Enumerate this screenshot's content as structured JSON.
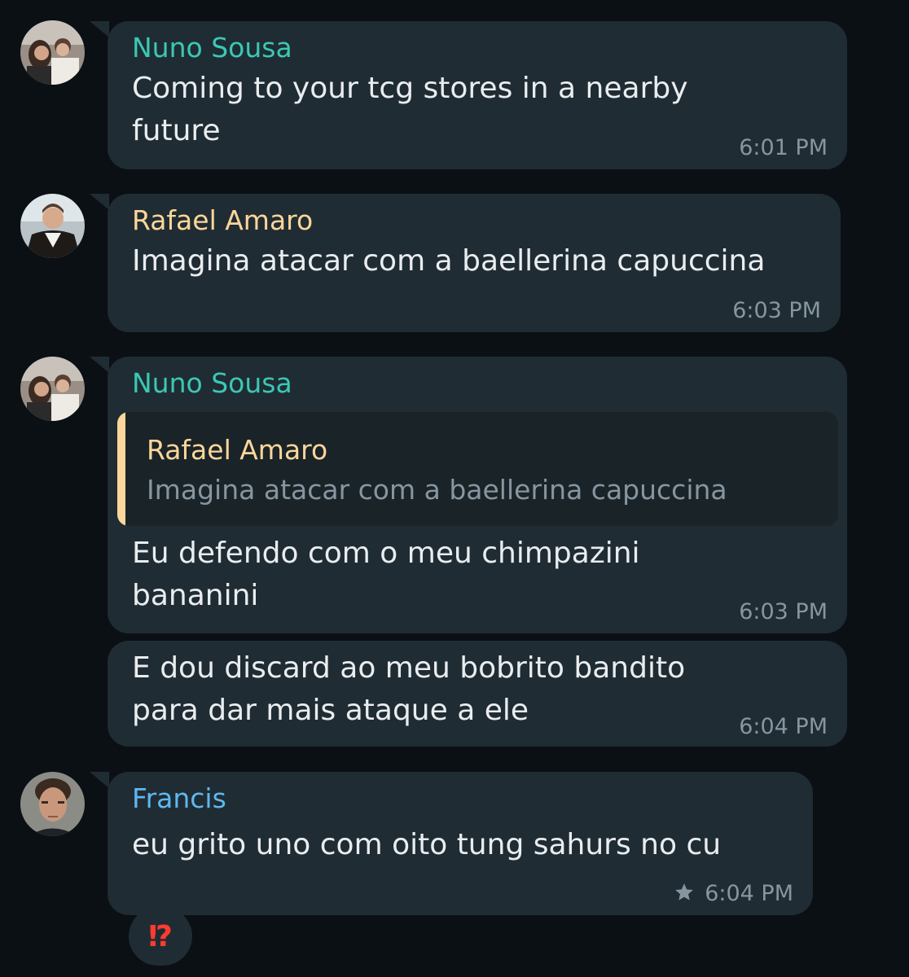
{
  "colors": {
    "background": "#0b1014",
    "bubble": "#202c33",
    "quote_bg": "#1a2328",
    "text": "#e9edef",
    "meta": "#8696a0",
    "nuno": "#3bc8b5",
    "rafael": "#fcd69a",
    "francis": "#5eb8f0",
    "reaction": "#ff3b30"
  },
  "messages": [
    {
      "sender": "Nuno Sousa",
      "line1": "Coming to your tcg stores in a nearby",
      "line2": "future",
      "time": "6:01 PM"
    },
    {
      "sender": "Rafael Amaro",
      "line1": "Imagina atacar com a baellerina capuccina",
      "time": "6:03 PM"
    },
    {
      "sender": "Nuno Sousa",
      "reply": {
        "sender": "Rafael Amaro",
        "text": "Imagina atacar com a baellerina capuccina"
      },
      "line1": "Eu defendo com o meu chimpazini",
      "line2": "bananini",
      "time": "6:03 PM"
    },
    {
      "line1": "E dou discard ao meu bobrito bandito",
      "line2": "para dar mais ataque a ele",
      "time": "6:04 PM"
    },
    {
      "sender": "Francis",
      "line1": "eu grito uno com oito tung sahurs no cu",
      "time": "6:04 PM",
      "starred_icon": "star-icon",
      "reaction": "⁉"
    }
  ]
}
